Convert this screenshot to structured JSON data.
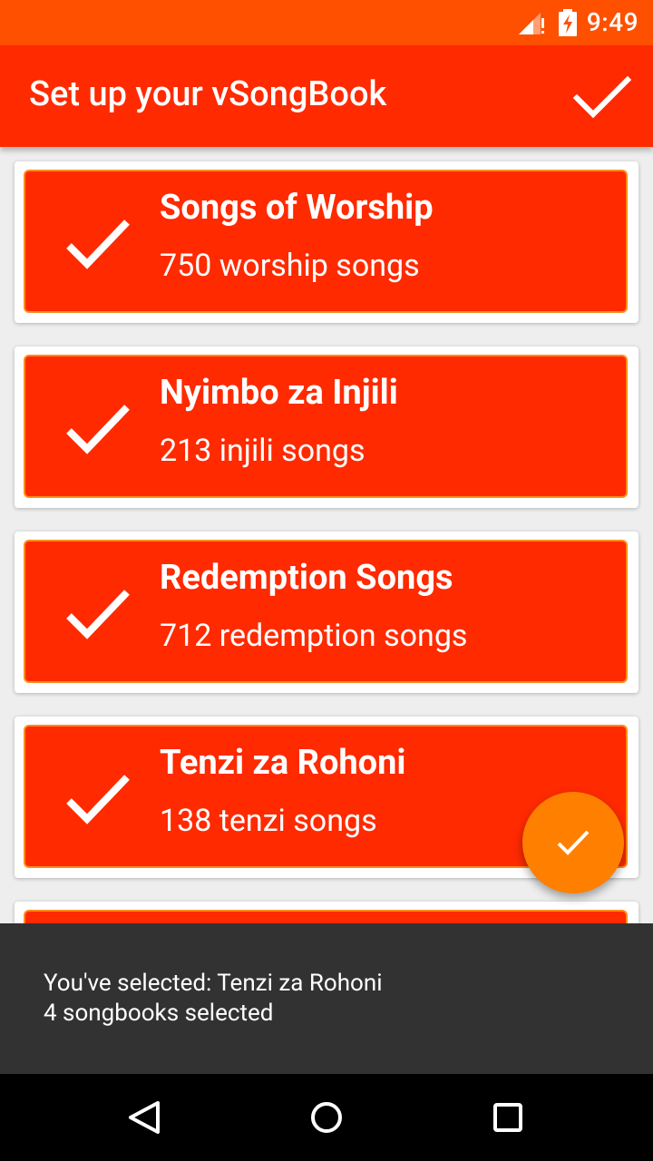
{
  "status_bar": {
    "time": "9:49",
    "icons": [
      "signal-icon",
      "battery-charging-icon"
    ],
    "color": "#ff5000"
  },
  "app_bar": {
    "title": "Set up your vSongBook",
    "action_icon": "check-icon",
    "color": "#ff2a00"
  },
  "songbooks": [
    {
      "title": "Songs of Worship",
      "subtitle": "750 worship songs",
      "selected": true
    },
    {
      "title": "Nyimbo za Injili",
      "subtitle": "213 injili songs",
      "selected": true
    },
    {
      "title": "Redemption Songs",
      "subtitle": "712 redemption songs",
      "selected": true
    },
    {
      "title": "Tenzi za Rohoni",
      "subtitle": "138 tenzi songs",
      "selected": true
    }
  ],
  "fab": {
    "icon": "check-icon",
    "color": "#ff7f00"
  },
  "snackbar": {
    "line1": "You've selected: Tenzi za Rohoni",
    "line2": "4 songbooks selected"
  },
  "nav_bar": {
    "icons": [
      "back-icon",
      "home-icon",
      "recents-icon"
    ]
  },
  "colors": {
    "accent": "#ff2a00",
    "card_border": "#ff8c1a",
    "background": "#eeeeee"
  }
}
